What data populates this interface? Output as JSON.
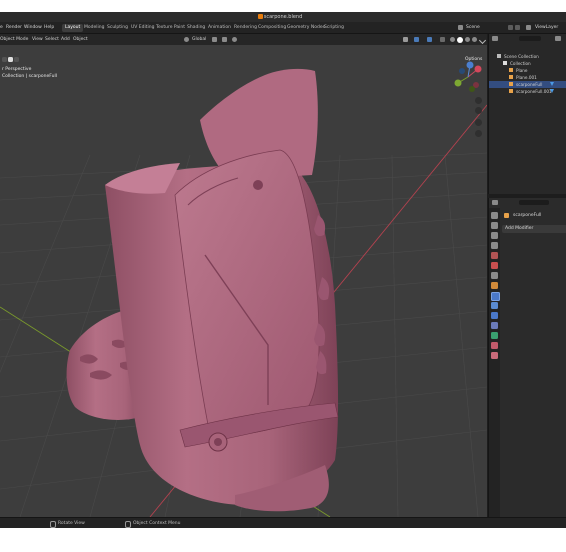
{
  "window": {
    "title": "scarpone.blend"
  },
  "menu": {
    "items": [
      "e",
      "Render",
      "Window",
      "Help"
    ]
  },
  "workspaces": {
    "tabs": [
      "Layout",
      "Modeling",
      "Sculpting",
      "UV Editing",
      "Texture Paint",
      "Shading",
      "Animation",
      "Rendering",
      "Compositing",
      "Geometry Nodes",
      "Scripting"
    ],
    "active": "Layout",
    "scene": "Scene",
    "view_layer": "ViewLayer"
  },
  "viewport_header": {
    "mode": "Object Mode",
    "menus": [
      "View",
      "Select",
      "Add",
      "Object"
    ],
    "transform_orientation": "Global",
    "options": "Options"
  },
  "viewport": {
    "view_name": "r Perspective",
    "collection_info": "Collection | scarponeFull",
    "shading": "solid",
    "model_color": "#b46f85",
    "grid_color": "#4a4a4a",
    "x_axis_color": "#b3424f",
    "y_axis_color": "#7a9a2c"
  },
  "outliner": {
    "root": "Scene Collection",
    "collection": "Collection",
    "items": [
      "Plane",
      "Plane.001",
      "scarponeFull",
      "scarponeFull.001"
    ]
  },
  "properties": {
    "object_name": "scarponeFull",
    "add_modifier": "Add Modifier"
  },
  "statusbar": {
    "left": "Rotate View",
    "middle": "Object Context Menu"
  }
}
